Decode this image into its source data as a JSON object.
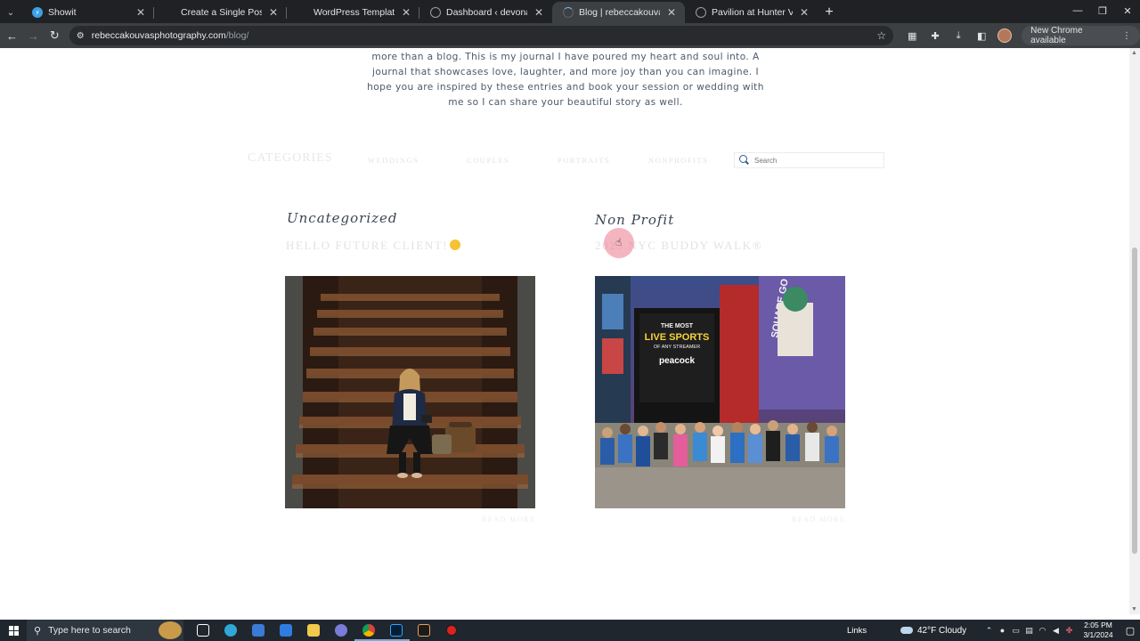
{
  "browser": {
    "tabs": [
      {
        "title": "Showit",
        "favicon_color": "#3aa0e8",
        "active": false
      },
      {
        "title": "Create a Single Post Template |",
        "favicon_color": "",
        "active": false
      },
      {
        "title": "WordPress Template Placeholde",
        "favicon_color": "",
        "active": false
      },
      {
        "title": "Dashboard ‹ devonadriannephc",
        "favicon_color": "#9aa0a6",
        "active": false
      },
      {
        "title": "Blog | rebeccakouvasphotograp",
        "favicon_color": "#5f6368",
        "active": true
      },
      {
        "title": "Pavilion at Hunter Valley - Wint",
        "favicon_color": "#9aa0a6",
        "active": false
      }
    ],
    "close_glyph": "✕",
    "new_tab_glyph": "+",
    "url_domain": "rebeccakouvasphotography.com",
    "url_path": "/blog/",
    "update_label": "New Chrome available"
  },
  "page": {
    "intro_text": "more than a blog. This is my journal I have poured my heart and soul into. A journal that showcases love, laughter, and more joy than you can imagine. I hope you are inspired by these entries and book your session or wedding with me so I can share your beautiful story as well.",
    "categories_heading": "CATEGORIES",
    "category_links": [
      "WEDDINGS",
      "COUPLES",
      "PORTRAITS",
      "NONPROFITS"
    ],
    "search_placeholder": "Search",
    "posts": [
      {
        "category": "Uncategorized",
        "title": "HELLO FUTURE CLIENT!",
        "read_more": "READ MORE"
      },
      {
        "category": "Non Profit",
        "title": "2023 NYC BUDDY WALK®",
        "read_more": "READ MORE"
      }
    ],
    "billboard_text": {
      "line1": "THE MOST",
      "line2": "LIVE SPORTS",
      "line3": "OF ANY STREAMER",
      "line4": "peacock",
      "side": "SQUARE GO TO"
    }
  },
  "taskbar": {
    "search_placeholder": "Type here to search",
    "links_label": "Links",
    "weather": "42°F  Cloudy",
    "time": "2:05 PM",
    "date": "3/1/2024"
  }
}
